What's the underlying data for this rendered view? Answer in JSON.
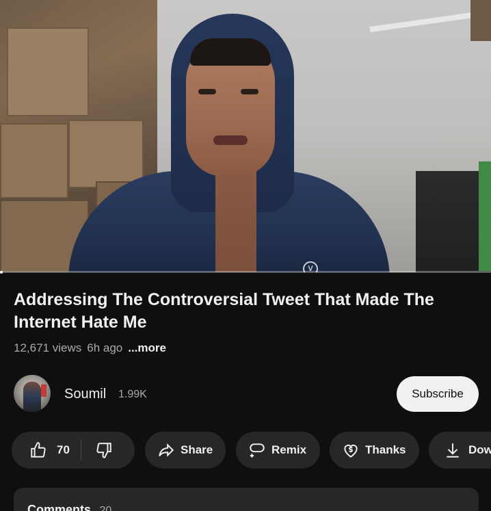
{
  "video": {
    "progress_fraction": 0.0,
    "badge_letter": "V"
  },
  "title": "Addressing The Controversial Tweet That Made The Internet Hate Me",
  "meta": {
    "views": "12,671 views",
    "age": "6h ago",
    "more": "...more"
  },
  "channel": {
    "name": "Soumil",
    "subscribers": "1.99K",
    "subscribe_label": "Subscribe"
  },
  "actions": {
    "like_count": "70",
    "share_label": "Share",
    "remix_label": "Remix",
    "thanks_label": "Thanks",
    "download_label": "Dow"
  },
  "comments": {
    "title": "Comments",
    "count": "20"
  },
  "icons": {
    "like": "thumbs-up-icon",
    "dislike": "thumbs-down-icon",
    "share": "share-arrow-icon",
    "remix": "remix-icon",
    "thanks": "heart-dollar-icon",
    "download": "download-icon"
  },
  "colors": {
    "background": "#0f0f0f",
    "pill": "#272727",
    "subscribe_bg": "#f1f1f1",
    "secondary_text": "#aaaaaa"
  }
}
